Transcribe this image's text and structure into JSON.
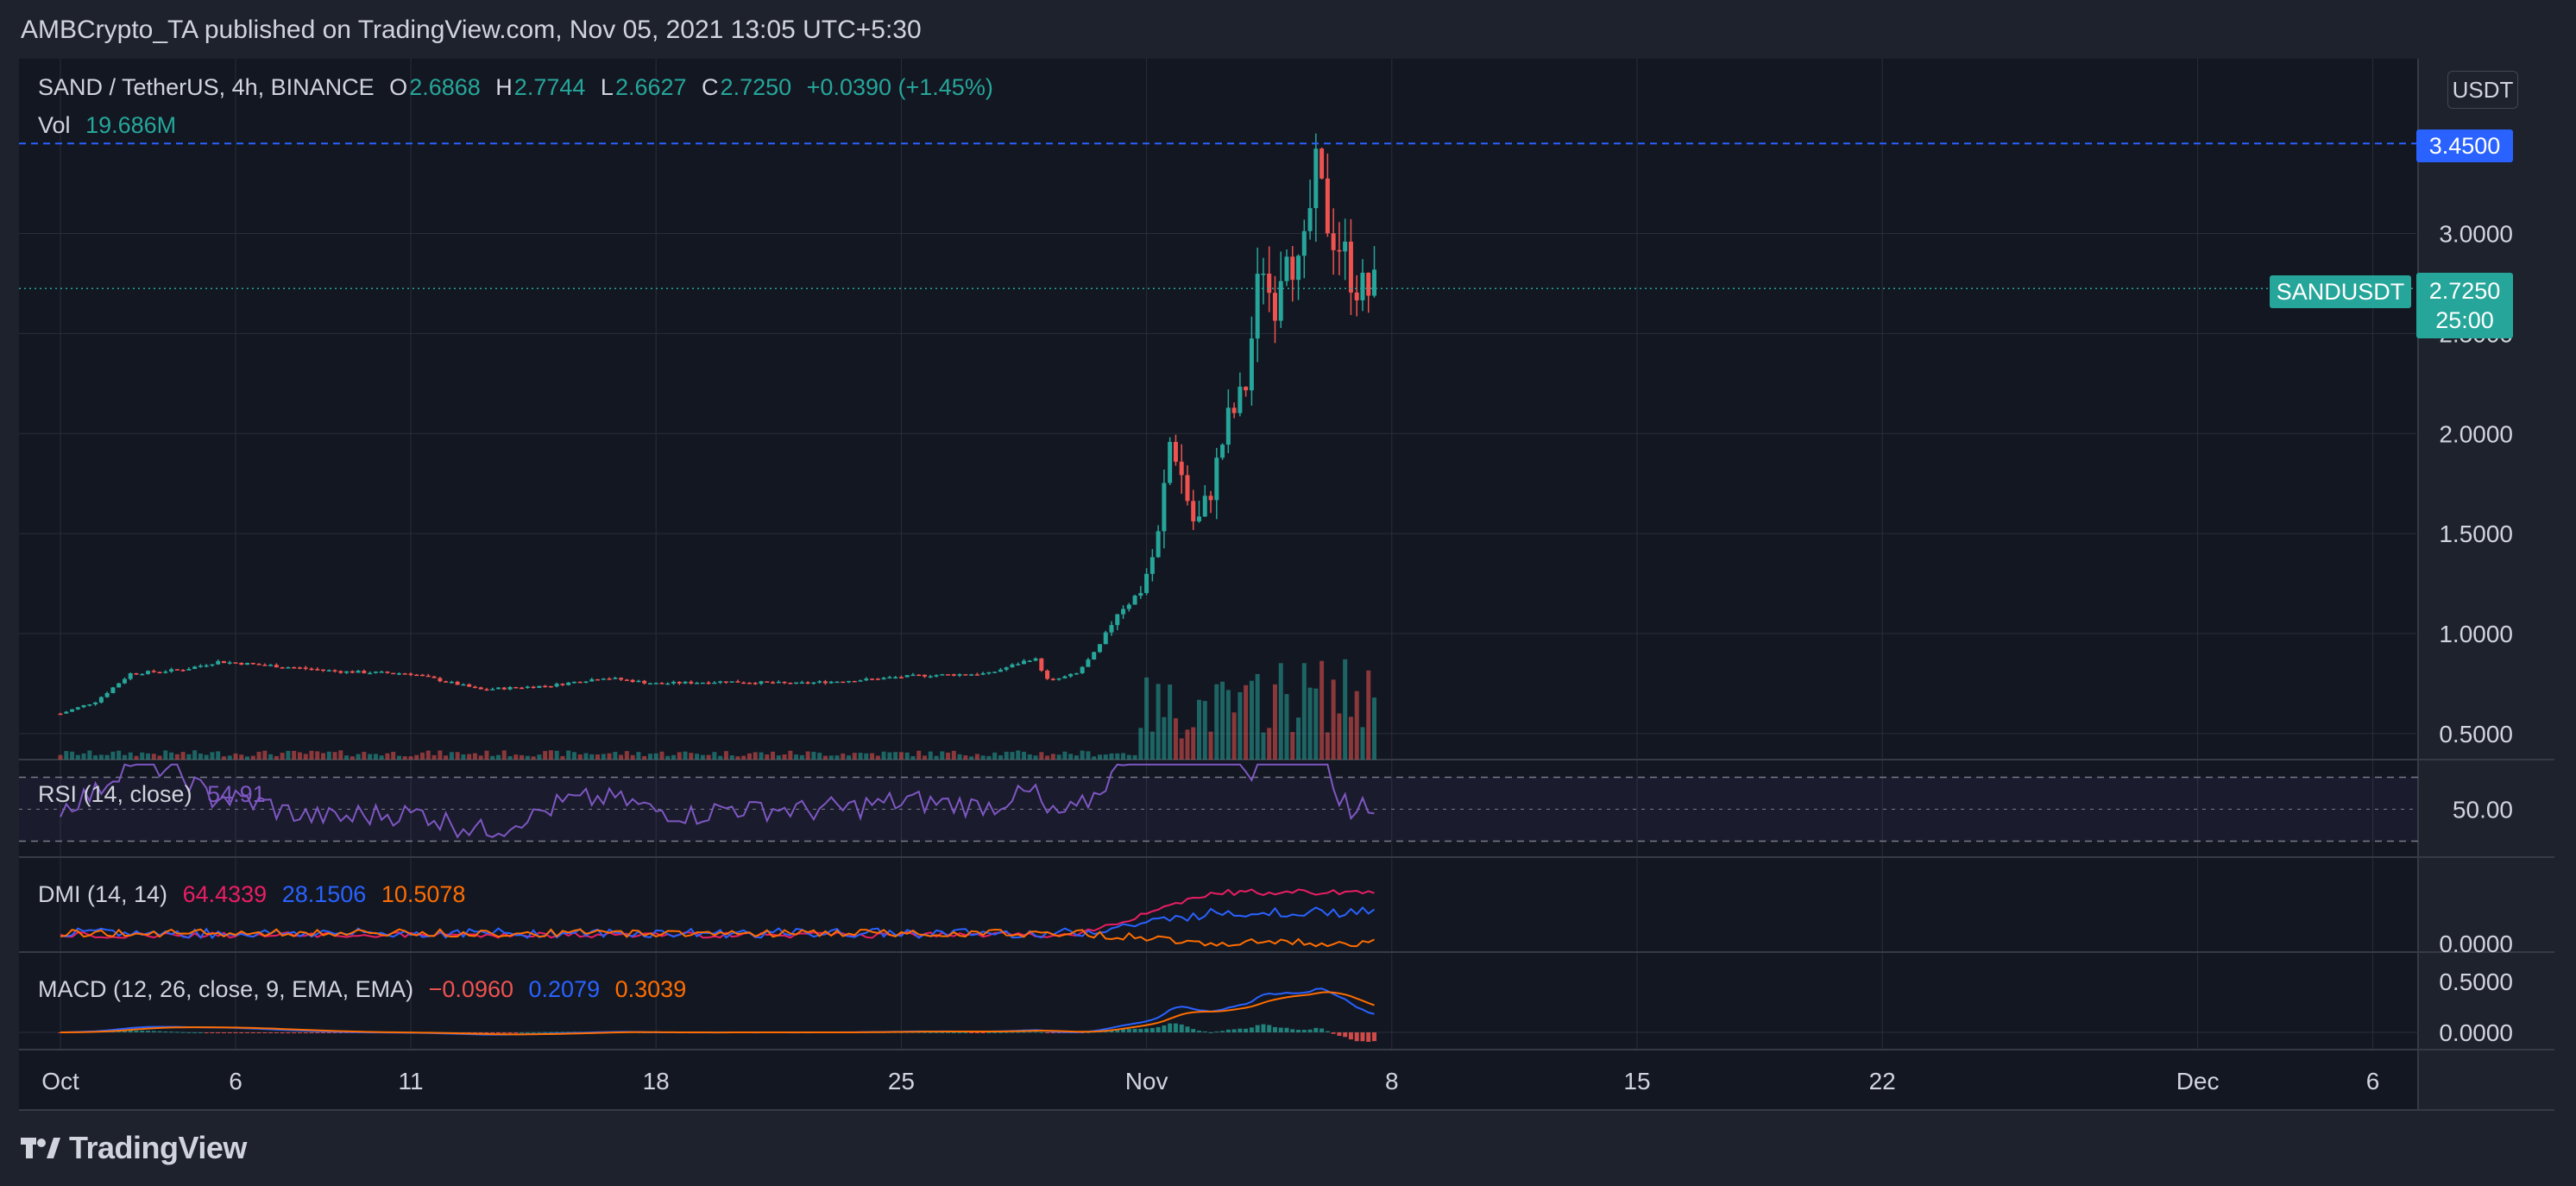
{
  "header": {
    "text": "AMBCrypto_TA published on TradingView.com, Nov 05, 2021 13:05 UTC+5:30"
  },
  "footer": {
    "brand": "TradingView"
  },
  "colors": {
    "background": "#1e222d",
    "up": "#26a69a",
    "down": "#ef5350",
    "rsi": "#7e57c2",
    "adx": "#e91e63",
    "diplus": "#2962ff",
    "diminus": "#ff6d00",
    "macd": "#2962ff",
    "signal": "#ff6d00",
    "accent": "#2962ff"
  },
  "icons": {
    "brand_logo": "tradingview-logo-icon"
  },
  "price_legend": {
    "symbol": "SAND / TetherUS, 4h, BINANCE",
    "o_label": "O",
    "o": "2.6868",
    "h_label": "H",
    "h": "2.7744",
    "l_label": "L",
    "l": "2.6627",
    "c_label": "C",
    "c": "2.7250",
    "change": "+0.0390 (+1.45%)"
  },
  "vol_legend": {
    "label": "Vol",
    "value": "19.686M"
  },
  "currency_button": "USDT",
  "price_badge": {
    "value": "3.4500"
  },
  "symbol_badge": {
    "name": "SANDUSDT",
    "price": "2.7250",
    "countdown": "25:00"
  },
  "rsi_legend": {
    "label": "RSI (14, close)",
    "value": "54.91"
  },
  "dmi_legend": {
    "label": "DMI (14, 14)",
    "adx": "64.4339",
    "plus": "28.1506",
    "minus": "10.5078"
  },
  "macd_legend": {
    "label": "MACD (12, 26, close, 9, EMA, EMA)",
    "hist": "−0.0960",
    "macd": "0.2079",
    "signal": "0.3039"
  },
  "chart_data": [
    {
      "type": "candlestick",
      "title": "SAND / TetherUS, 4h, BINANCE",
      "x_ticks": [
        "Oct",
        "6",
        "11",
        "18",
        "25",
        "Nov",
        "8",
        "15",
        "22",
        "Dec",
        "6"
      ],
      "y_ticks": [
        "0.5000",
        "1.0000",
        "1.5000",
        "2.0000",
        "2.5000",
        "3.0000"
      ],
      "ylim": [
        0.37,
        3.52
      ],
      "grid": true,
      "markers": {
        "high_line": 3.45,
        "last_price": 2.725
      },
      "keypoints": [
        {
          "d": 0,
          "p": 0.6
        },
        {
          "d": 1,
          "p": 0.66
        },
        {
          "d": 2,
          "p": 0.8
        },
        {
          "d": 3.5,
          "p": 0.82
        },
        {
          "d": 4.5,
          "p": 0.86
        },
        {
          "d": 6,
          "p": 0.84
        },
        {
          "d": 8,
          "p": 0.81
        },
        {
          "d": 10,
          "p": 0.8
        },
        {
          "d": 12,
          "p": 0.72
        },
        {
          "d": 14,
          "p": 0.74
        },
        {
          "d": 15.5,
          "p": 0.78
        },
        {
          "d": 17,
          "p": 0.75
        },
        {
          "d": 19,
          "p": 0.76
        },
        {
          "d": 21,
          "p": 0.75
        },
        {
          "d": 23,
          "p": 0.77
        },
        {
          "d": 24.5,
          "p": 0.79
        },
        {
          "d": 26.5,
          "p": 0.8
        },
        {
          "d": 27.8,
          "p": 0.88
        },
        {
          "d": 28.2,
          "p": 0.76
        },
        {
          "d": 29,
          "p": 0.8
        },
        {
          "d": 29.6,
          "p": 0.92
        },
        {
          "d": 30.2,
          "p": 1.12
        },
        {
          "d": 30.8,
          "p": 1.2
        },
        {
          "d": 31.3,
          "p": 1.45
        },
        {
          "d": 31.7,
          "p": 2.0
        },
        {
          "d": 32.1,
          "p": 1.72
        },
        {
          "d": 32.4,
          "p": 1.52
        },
        {
          "d": 32.8,
          "p": 1.7
        },
        {
          "d": 33.3,
          "p": 2.05
        },
        {
          "d": 33.8,
          "p": 2.2
        },
        {
          "d": 34.3,
          "p": 2.9
        },
        {
          "d": 34.6,
          "p": 2.62
        },
        {
          "d": 35.0,
          "p": 3.0
        },
        {
          "d": 35.4,
          "p": 2.75
        },
        {
          "d": 35.8,
          "p": 3.3
        },
        {
          "d": 36.2,
          "p": 3.05
        },
        {
          "d": 36.5,
          "p": 2.95
        },
        {
          "d": 36.9,
          "p": 2.78
        },
        {
          "d": 37.2,
          "p": 2.7
        },
        {
          "d": 37.5,
          "p": 2.72
        }
      ]
    },
    {
      "type": "bar",
      "title": "Vol",
      "last": "19.686M"
    },
    {
      "type": "line",
      "title": "RSI (14, close)",
      "y_ticks": [
        "50.00"
      ],
      "bands": [
        70,
        50,
        30
      ],
      "last": 54.91
    },
    {
      "type": "line",
      "title": "DMI (14, 14)",
      "series": [
        {
          "name": "ADX",
          "last": 64.4339
        },
        {
          "name": "+DI",
          "last": 28.1506
        },
        {
          "name": "-DI",
          "last": 10.5078
        }
      ],
      "y_ticks": [
        "0.0000"
      ]
    },
    {
      "type": "line",
      "title": "MACD (12, 26, close, 9, EMA, EMA)",
      "series": [
        {
          "name": "Histogram",
          "last": -0.096
        },
        {
          "name": "MACD",
          "last": 0.2079
        },
        {
          "name": "Signal",
          "last": 0.3039
        }
      ],
      "y_ticks": [
        "0.5000",
        "0.0000"
      ]
    }
  ]
}
